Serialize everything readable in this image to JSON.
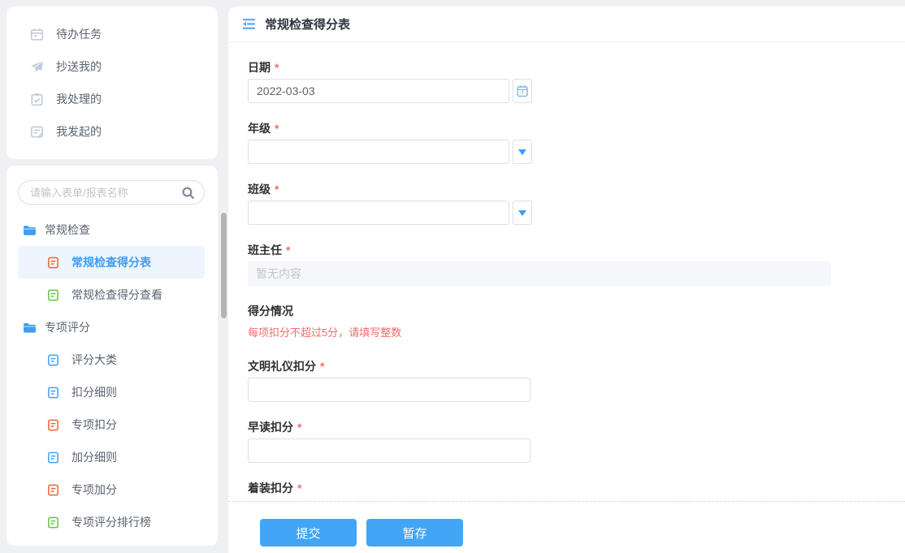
{
  "sidebar": {
    "nav": [
      {
        "label": "待办任务",
        "icon": "todo-calendar-icon"
      },
      {
        "label": "抄送我的",
        "icon": "send-icon"
      },
      {
        "label": "我处理的",
        "icon": "clipboard-check-icon"
      },
      {
        "label": "我发起的",
        "icon": "edit-document-icon"
      }
    ],
    "search_placeholder": "请输入表单/报表名称",
    "tree": [
      {
        "label": "常规检查",
        "type": "folder"
      },
      {
        "label": "常规检查得分表",
        "type": "doc",
        "color": "#f5622d",
        "selected": true
      },
      {
        "label": "常规检查得分查看",
        "type": "doc",
        "color": "#67c23a"
      },
      {
        "label": "专项评分",
        "type": "folder"
      },
      {
        "label": "评分大类",
        "type": "doc",
        "color": "#409eff"
      },
      {
        "label": "扣分细则",
        "type": "doc",
        "color": "#409eff"
      },
      {
        "label": "专项扣分",
        "type": "doc",
        "color": "#f5622d"
      },
      {
        "label": "加分细则",
        "type": "doc",
        "color": "#409eff"
      },
      {
        "label": "专项加分",
        "type": "doc",
        "color": "#f5622d"
      },
      {
        "label": "专项评分排行榜",
        "type": "doc",
        "color": "#67c23a"
      }
    ]
  },
  "header": {
    "title": "常规检查得分表"
  },
  "form": {
    "required_mark": "*",
    "date": {
      "label": "日期",
      "value": "2022-03-03"
    },
    "grade": {
      "label": "年级",
      "value": ""
    },
    "clazz": {
      "label": "班级",
      "value": ""
    },
    "teacher": {
      "label": "班主任",
      "placeholder": "暂无内容"
    },
    "section_title": "得分情况",
    "hint": "每项扣分不超过5分，请填写整数",
    "score1": {
      "label": "文明礼仪扣分",
      "value": ""
    },
    "score2": {
      "label": "早读扣分",
      "value": ""
    },
    "score3": {
      "label": "着装扣分",
      "value": ""
    }
  },
  "footer": {
    "submit_label": "提交",
    "save_label": "暂存"
  },
  "colors": {
    "accent": "#409eff",
    "button": "#42a5f5",
    "required": "#f56c6c",
    "hint_text": "#f56c6c",
    "selected_item_bg": "#edf5fe",
    "doc_icon_blue": "#409eff",
    "doc_icon_green": "#67c23a",
    "doc_icon_orange": "#f5622d",
    "page_bg": "#eef0f4"
  }
}
